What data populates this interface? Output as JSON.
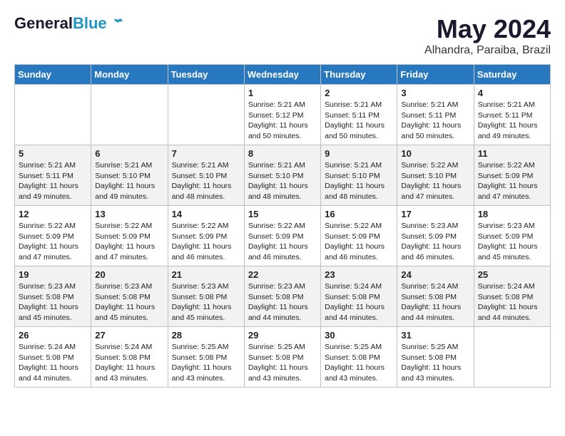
{
  "logo": {
    "general": "General",
    "blue": "Blue"
  },
  "title": "May 2024",
  "subtitle": "Alhandra, Paraiba, Brazil",
  "headers": [
    "Sunday",
    "Monday",
    "Tuesday",
    "Wednesday",
    "Thursday",
    "Friday",
    "Saturday"
  ],
  "rows": [
    [
      {
        "day": "",
        "info": ""
      },
      {
        "day": "",
        "info": ""
      },
      {
        "day": "",
        "info": ""
      },
      {
        "day": "1",
        "info": "Sunrise: 5:21 AM\nSunset: 5:12 PM\nDaylight: 11 hours\nand 50 minutes."
      },
      {
        "day": "2",
        "info": "Sunrise: 5:21 AM\nSunset: 5:11 PM\nDaylight: 11 hours\nand 50 minutes."
      },
      {
        "day": "3",
        "info": "Sunrise: 5:21 AM\nSunset: 5:11 PM\nDaylight: 11 hours\nand 50 minutes."
      },
      {
        "day": "4",
        "info": "Sunrise: 5:21 AM\nSunset: 5:11 PM\nDaylight: 11 hours\nand 49 minutes."
      }
    ],
    [
      {
        "day": "5",
        "info": "Sunrise: 5:21 AM\nSunset: 5:11 PM\nDaylight: 11 hours\nand 49 minutes."
      },
      {
        "day": "6",
        "info": "Sunrise: 5:21 AM\nSunset: 5:10 PM\nDaylight: 11 hours\nand 49 minutes."
      },
      {
        "day": "7",
        "info": "Sunrise: 5:21 AM\nSunset: 5:10 PM\nDaylight: 11 hours\nand 48 minutes."
      },
      {
        "day": "8",
        "info": "Sunrise: 5:21 AM\nSunset: 5:10 PM\nDaylight: 11 hours\nand 48 minutes."
      },
      {
        "day": "9",
        "info": "Sunrise: 5:21 AM\nSunset: 5:10 PM\nDaylight: 11 hours\nand 48 minutes."
      },
      {
        "day": "10",
        "info": "Sunrise: 5:22 AM\nSunset: 5:10 PM\nDaylight: 11 hours\nand 47 minutes."
      },
      {
        "day": "11",
        "info": "Sunrise: 5:22 AM\nSunset: 5:09 PM\nDaylight: 11 hours\nand 47 minutes."
      }
    ],
    [
      {
        "day": "12",
        "info": "Sunrise: 5:22 AM\nSunset: 5:09 PM\nDaylight: 11 hours\nand 47 minutes."
      },
      {
        "day": "13",
        "info": "Sunrise: 5:22 AM\nSunset: 5:09 PM\nDaylight: 11 hours\nand 47 minutes."
      },
      {
        "day": "14",
        "info": "Sunrise: 5:22 AM\nSunset: 5:09 PM\nDaylight: 11 hours\nand 46 minutes."
      },
      {
        "day": "15",
        "info": "Sunrise: 5:22 AM\nSunset: 5:09 PM\nDaylight: 11 hours\nand 46 minutes."
      },
      {
        "day": "16",
        "info": "Sunrise: 5:22 AM\nSunset: 5:09 PM\nDaylight: 11 hours\nand 46 minutes."
      },
      {
        "day": "17",
        "info": "Sunrise: 5:23 AM\nSunset: 5:09 PM\nDaylight: 11 hours\nand 46 minutes."
      },
      {
        "day": "18",
        "info": "Sunrise: 5:23 AM\nSunset: 5:09 PM\nDaylight: 11 hours\nand 45 minutes."
      }
    ],
    [
      {
        "day": "19",
        "info": "Sunrise: 5:23 AM\nSunset: 5:08 PM\nDaylight: 11 hours\nand 45 minutes."
      },
      {
        "day": "20",
        "info": "Sunrise: 5:23 AM\nSunset: 5:08 PM\nDaylight: 11 hours\nand 45 minutes."
      },
      {
        "day": "21",
        "info": "Sunrise: 5:23 AM\nSunset: 5:08 PM\nDaylight: 11 hours\nand 45 minutes."
      },
      {
        "day": "22",
        "info": "Sunrise: 5:23 AM\nSunset: 5:08 PM\nDaylight: 11 hours\nand 44 minutes."
      },
      {
        "day": "23",
        "info": "Sunrise: 5:24 AM\nSunset: 5:08 PM\nDaylight: 11 hours\nand 44 minutes."
      },
      {
        "day": "24",
        "info": "Sunrise: 5:24 AM\nSunset: 5:08 PM\nDaylight: 11 hours\nand 44 minutes."
      },
      {
        "day": "25",
        "info": "Sunrise: 5:24 AM\nSunset: 5:08 PM\nDaylight: 11 hours\nand 44 minutes."
      }
    ],
    [
      {
        "day": "26",
        "info": "Sunrise: 5:24 AM\nSunset: 5:08 PM\nDaylight: 11 hours\nand 44 minutes."
      },
      {
        "day": "27",
        "info": "Sunrise: 5:24 AM\nSunset: 5:08 PM\nDaylight: 11 hours\nand 43 minutes."
      },
      {
        "day": "28",
        "info": "Sunrise: 5:25 AM\nSunset: 5:08 PM\nDaylight: 11 hours\nand 43 minutes."
      },
      {
        "day": "29",
        "info": "Sunrise: 5:25 AM\nSunset: 5:08 PM\nDaylight: 11 hours\nand 43 minutes."
      },
      {
        "day": "30",
        "info": "Sunrise: 5:25 AM\nSunset: 5:08 PM\nDaylight: 11 hours\nand 43 minutes."
      },
      {
        "day": "31",
        "info": "Sunrise: 5:25 AM\nSunset: 5:08 PM\nDaylight: 11 hours\nand 43 minutes."
      },
      {
        "day": "",
        "info": ""
      }
    ]
  ]
}
